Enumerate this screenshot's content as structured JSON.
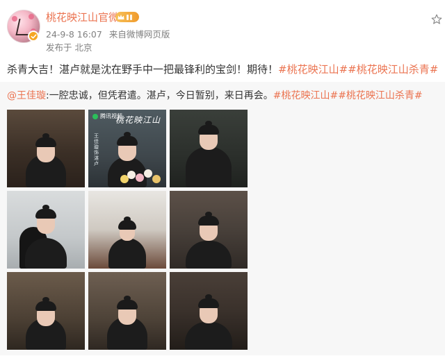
{
  "account": {
    "name": "桃花映江山官微",
    "timestamp": "24-9-8 16:07",
    "source": "来自微博网页版",
    "location": "发布于 北京"
  },
  "post": {
    "text": "杀青大吉！湛卢就是沈在野手中一把最锋利的宝剑！期待！",
    "hashtag_1": "#桃花映江山#",
    "hashtag_2": "#桃花映江山杀青#"
  },
  "quoted": {
    "mention": "@王佳璇",
    "text": ":一腔忠诚，但凭君遣。湛卢，今日暂别，来日再会。",
    "hashtag_1": "#桃花映江山#",
    "hashtag_2": "#桃花映江山杀青#"
  },
  "photos": {
    "poster_watermark": "腾讯视频",
    "poster_title": "桃花映江山",
    "poster_subtitle": "王佳璇饰湛卢"
  },
  "icons": {
    "verify": "verified-check-icon",
    "vip": "vip-crown-icon",
    "follow": "star-outline-icon"
  },
  "colors": {
    "accent": "#eb7350",
    "meta": "#808080",
    "quote_bg": "#f7f7f7",
    "verify_badge": "#f5a623"
  }
}
